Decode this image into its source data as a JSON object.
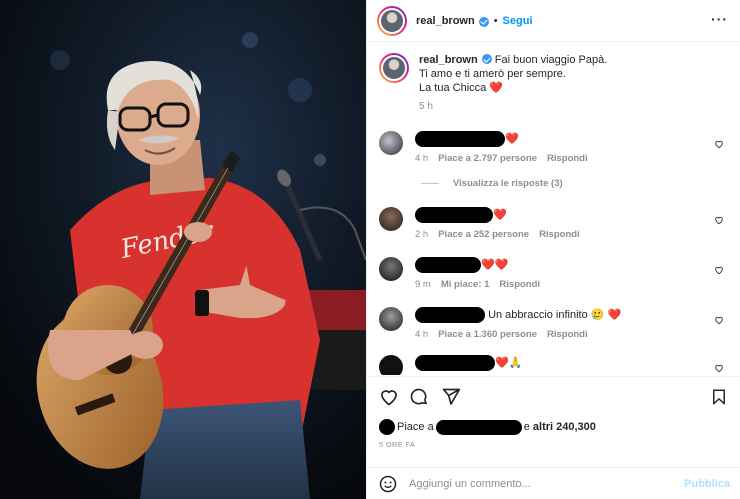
{
  "colors": {
    "accent": "#0095f6",
    "verified": "#3897f0",
    "heart": "#e0245e",
    "muted": "#8e8e8e",
    "publish_disabled": "#b2dffc",
    "shirt": "#d8322f"
  },
  "photo": {
    "shirt_text": "Fender"
  },
  "header": {
    "username": "real_brown",
    "separator": "•",
    "follow_label": "Segui",
    "more_icon": "more-horizontal-icon"
  },
  "caption": {
    "username": "real_brown",
    "line1": "Fai buon viaggio Papà.",
    "line2": "Ti amo e ti amerò per sempre.",
    "line3": "La tua Chicca",
    "emoji": "❤️",
    "time": "5 h"
  },
  "comments": [
    {
      "text": "",
      "emoji": "❤️",
      "time": "4 h",
      "likes": "Piace a 2.797 persone",
      "reply": "Rispondi"
    },
    {
      "text": "",
      "emoji": "❤️",
      "time": "2 h",
      "likes": "Piace a 252 persone",
      "reply": "Rispondi"
    },
    {
      "text": "",
      "emoji": "❤️❤️",
      "time": "9 m",
      "likes": "Mi piace: 1",
      "reply": "Rispondi"
    },
    {
      "text": "Un abbraccio infinito",
      "emoji": "🥲 ❤️",
      "time": "4 h",
      "likes": "Piace a 1.360 persone",
      "reply": "Rispondi"
    },
    {
      "text": "",
      "emoji": "❤️🙏",
      "time": "",
      "likes": "",
      "reply": ""
    }
  ],
  "view_replies": "Visualizza le risposte (3)",
  "actions": {
    "like_icon": "heart-outline-icon",
    "comment_icon": "comment-bubble-icon",
    "share_icon": "paper-plane-icon",
    "save_icon": "bookmark-icon"
  },
  "likes_line": {
    "prefix": "Piace a",
    "connector": "e",
    "others": "altri 240,300"
  },
  "timestamp": "5 ORE FA",
  "add_comment": {
    "emoji_icon": "smiley-icon",
    "placeholder": "Aggiungi un commento...",
    "publish_label": "Pubblica"
  }
}
